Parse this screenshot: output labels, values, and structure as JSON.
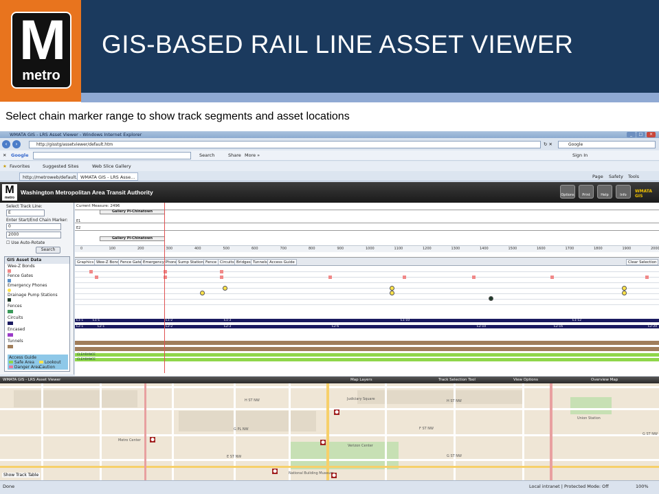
{
  "slide": {
    "logo_letter": "M",
    "logo_text": "metro",
    "title": "GIS-BASED RAIL LINE ASSET VIEWER",
    "caption": "Select chain marker range to show track segments and asset locations"
  },
  "browser": {
    "window_title": "WMATA GIS - LRS Asset Viewer - Windows Internet Explorer",
    "address": "http://gisstg/assetviewer/default.htm",
    "search_label": "Google",
    "google_label": "Google",
    "google_search_btn": "Search",
    "share_btn": "Share",
    "more_btn": "More »",
    "sign_in": "Sign In",
    "favorites": "Favorites",
    "suggested_sites": "Suggested Sites",
    "web_slice": "Web Slice Gallery",
    "tabs": [
      "http://metroweb/default.a...",
      "WMATA GIS - LRS Asse..."
    ],
    "menu": [
      "Page",
      "Safety",
      "Tools"
    ],
    "status_left": "Done",
    "status_right": "Local intranet | Protected Mode: Off",
    "zoom": "100%"
  },
  "app": {
    "title": "Washington Metropolitan Area Transit Authority",
    "brand": "WMATA GIS",
    "buttons": [
      "Options",
      "Print",
      "Help",
      "Info"
    ],
    "select_track_label": "Select Track Line:",
    "track_value": "E",
    "chain_label": "Enter Start/End Chain Marker:",
    "start_value": "0",
    "end_value": "2000",
    "auto_rotate": "Use Auto-Rotate",
    "search_btn": "Search",
    "current_measure": "Current Measure: 2496",
    "station_top": "Gallery Pl-Chinatown",
    "station_bottom": "Gallery Pl-Chinatown",
    "track_e1": "E1",
    "track_e2": "E2",
    "clear_selection": "Clear Selection",
    "ruler": [
      "0",
      "100",
      "200",
      "300",
      "400",
      "500",
      "600",
      "700",
      "800",
      "900",
      "1000",
      "1100",
      "1200",
      "1300",
      "1400",
      "1500",
      "1600",
      "1700",
      "1800",
      "1900",
      "2000"
    ],
    "asset_tabs": [
      "Graphics",
      "Wee-Z Bond",
      "Fence Gate",
      "Emergency Phones",
      "Sump Stations",
      "Fence",
      "Circuits",
      "Bridges",
      "Tunnels",
      "Access Guide"
    ],
    "legend_title": "GIS Asset Data",
    "legend": [
      "Wee-Z Bonds",
      "Fence Gates",
      "Emergency Phones",
      "Drainage Pump Stations",
      "Fences",
      "Circuits",
      "Encased",
      "Tunnels",
      "Access Guide"
    ],
    "access_items": [
      "Safe Area",
      "Lookout Caution",
      "Danger Area"
    ],
    "bar_labels_top": [
      "E1-1",
      "E1-1",
      "E1-2",
      "E1-3",
      "E1-10",
      "E1-12"
    ],
    "bar_labels_bottom": [
      "E2-1",
      "E2-1",
      "E2-2",
      "E2-3",
      "E2-6",
      "E2-10",
      "E2-16",
      "E2-20"
    ],
    "clearance": [
      "CLEARANCE",
      "CLEARANCE"
    ]
  },
  "map": {
    "header_left": "WMATA GIS - LRS Asset Viewer",
    "header_tabs": [
      "Map Layers",
      "Track Selection Tool",
      "View Options",
      "Overview Map"
    ],
    "labels": [
      "H ST NW",
      "H ST NW",
      "G PL NW",
      "G ST NW",
      "E ST NW",
      "F ST NW",
      "G ST NW",
      "Verizon Center",
      "National Building Museum",
      "Union Station",
      "Metro Center",
      "Judiciary Square"
    ],
    "show_track_table": "Show Track Table"
  },
  "colors": {
    "slide_navy": "#1b3a5e",
    "logo_orange": "#e8741e",
    "strip_blue": "#8fa9d3",
    "track_navy": "#1a1a60",
    "fence_brown": "#a07d5a",
    "clearance_green": "#8fd64a"
  }
}
